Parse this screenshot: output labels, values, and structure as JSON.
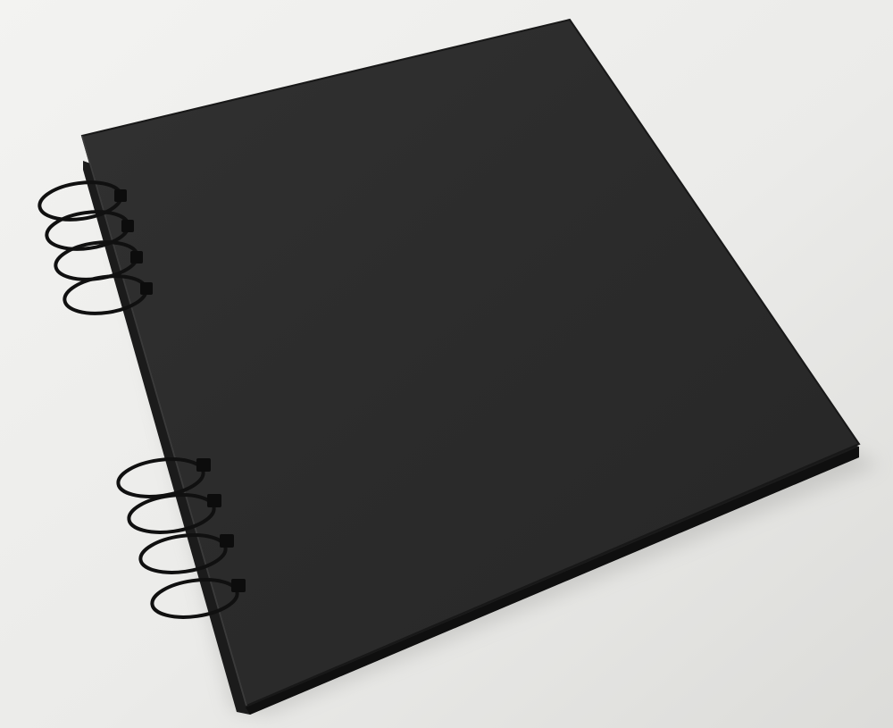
{
  "photo": {
    "subject": "black-spiral-bound-album",
    "colors": {
      "background_light": "#f2f2f0",
      "background_shadow": "#d9d9d6",
      "cover": "#2b2b2b",
      "cover_highlight": "#333333",
      "cover_edge": "#151515",
      "page_block": "#1c1c1c",
      "wire": "#111111"
    },
    "binding": {
      "ring_groups": 2,
      "rings_per_group": 4
    }
  }
}
